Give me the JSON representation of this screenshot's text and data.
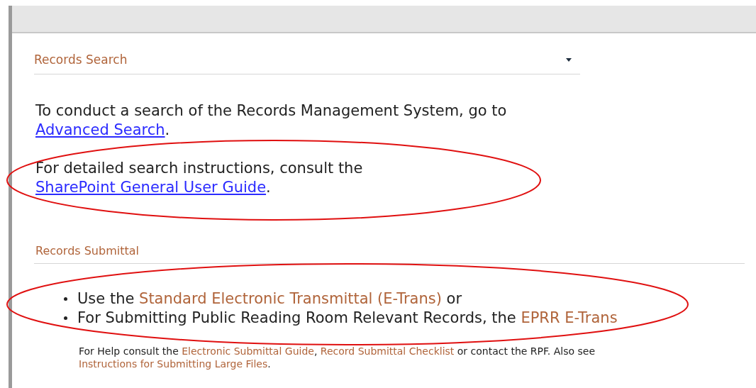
{
  "search_section": {
    "title": "Records Search",
    "paragraphs": [
      [
        {
          "kind": "text",
          "text": "To conduct a search of the Records Management System, go to "
        },
        {
          "kind": "link",
          "text": "Advanced Search"
        },
        {
          "kind": "text",
          "text": "."
        }
      ],
      [
        {
          "kind": "text",
          "text": "For detailed search instructions, consult the "
        },
        {
          "kind": "link",
          "text": "SharePoint General User Guide"
        },
        {
          "kind": "text",
          "text": "."
        }
      ]
    ]
  },
  "submittal_section": {
    "title": "Records Submittal",
    "bullets": [
      [
        {
          "kind": "text",
          "text": "Use the "
        },
        {
          "kind": "accent_link",
          "text": "Standard Electronic Transmittal (E-Trans)"
        },
        {
          "kind": "text",
          "text": " or"
        }
      ],
      [
        {
          "kind": "text",
          "text": "For Submitting Public Reading Room Relevant Records, the "
        },
        {
          "kind": "accent_link",
          "text": "EPRR E-Trans"
        }
      ]
    ],
    "help": [
      {
        "kind": "text",
        "text": "For Help consult the "
      },
      {
        "kind": "accent_link",
        "text": "Electronic Submittal Guide"
      },
      {
        "kind": "text",
        "text": ", "
      },
      {
        "kind": "accent_link",
        "text": "Record Submittal Checklist"
      },
      {
        "kind": "text",
        "text": " or contact the RPF. Also see "
      },
      {
        "kind": "accent_link",
        "text": "Instructions for Submitting Large Files"
      },
      {
        "kind": "text",
        "text": "."
      }
    ]
  },
  "annotations": [
    {
      "kind": "ellipse"
    },
    {
      "kind": "ellipse"
    }
  ]
}
